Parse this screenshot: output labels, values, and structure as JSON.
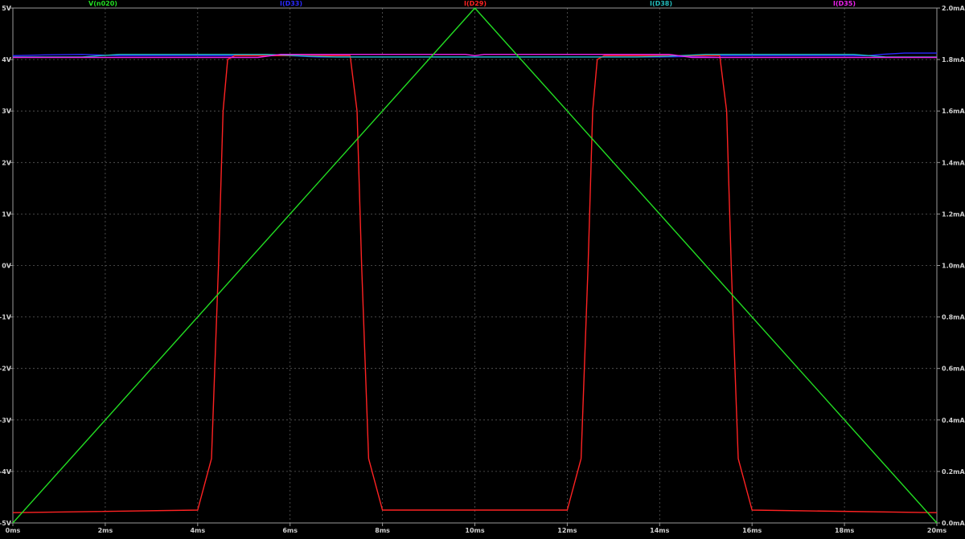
{
  "chart_data": {
    "type": "line",
    "background": "#000000",
    "grid": true,
    "grid_color": "#5a5a5a",
    "axis_color": "#9a9a9a",
    "tick_label_color": "#d0d0d0",
    "x_axis": {
      "range": [
        0,
        20
      ],
      "ticks": [
        0,
        2,
        4,
        6,
        8,
        10,
        12,
        14,
        16,
        18,
        20
      ],
      "tick_labels": [
        "0ms",
        "2ms",
        "4ms",
        "6ms",
        "8ms",
        "10ms",
        "12ms",
        "14ms",
        "16ms",
        "18ms",
        "20ms"
      ]
    },
    "y_left": {
      "range": [
        -5,
        5
      ],
      "ticks": [
        -5,
        -4,
        -3,
        -2,
        -1,
        0,
        1,
        2,
        3,
        4,
        5
      ],
      "tick_labels": [
        "-5V",
        "-4V",
        "-3V",
        "-2V",
        "-1V",
        "0V",
        "1V",
        "2V",
        "3V",
        "4V",
        "5V"
      ]
    },
    "y_right": {
      "range": [
        0,
        2
      ],
      "ticks": [
        0,
        0.2,
        0.4,
        0.6,
        0.8,
        1.0,
        1.2,
        1.4,
        1.6,
        1.8,
        2.0
      ],
      "tick_labels": [
        "0.0mA",
        "0.2mA",
        "0.4mA",
        "0.6mA",
        "0.8mA",
        "1.0mA",
        "1.2mA",
        "1.4mA",
        "1.6mA",
        "1.8mA",
        "2.0mA"
      ]
    },
    "legend_position": "top",
    "series": [
      {
        "name": "V(n020)",
        "color": "#22dd22",
        "axis": "left",
        "x": [
          0,
          10,
          20
        ],
        "y": [
          -5,
          5,
          -5
        ]
      },
      {
        "name": "I(D33)",
        "color": "#2a2aff",
        "axis": "right",
        "x": [
          0,
          0.7,
          1.5,
          2.3,
          5.5,
          6.0,
          6.6,
          14.0,
          14.7,
          15.3,
          18.5,
          18.8,
          19.3,
          20
        ],
        "y": [
          1.815,
          1.818,
          1.82,
          1.815,
          1.815,
          1.815,
          1.81,
          1.81,
          1.812,
          1.815,
          1.815,
          1.82,
          1.825,
          1.825
        ]
      },
      {
        "name": "I(D29)",
        "color": "#ff2222",
        "axis": "right",
        "x": [
          0,
          4.0,
          4.3,
          4.45,
          4.55,
          4.65,
          4.8,
          7.3,
          7.45,
          7.55,
          7.7,
          8.0,
          12.0,
          12.3,
          12.45,
          12.55,
          12.65,
          12.8,
          15.3,
          15.45,
          15.55,
          15.7,
          16.0,
          20
        ],
        "y": [
          0.04,
          0.05,
          0.25,
          1.0,
          1.6,
          1.8,
          1.815,
          1.815,
          1.6,
          1.0,
          0.25,
          0.05,
          0.05,
          0.25,
          1.0,
          1.6,
          1.8,
          1.815,
          1.815,
          1.6,
          1.0,
          0.25,
          0.05,
          0.04
        ]
      },
      {
        "name": "I(D38)",
        "color": "#22bbbb",
        "axis": "right",
        "x": [
          0,
          1.5,
          2.3,
          5.5,
          6.4,
          7.0,
          13.5,
          14.2,
          15.0,
          18.2,
          18.9,
          20
        ],
        "y": [
          1.81,
          1.81,
          1.82,
          1.82,
          1.813,
          1.81,
          1.81,
          1.813,
          1.82,
          1.82,
          1.81,
          1.81
        ]
      },
      {
        "name": "I(D35)",
        "color": "#ee22ee",
        "axis": "right",
        "x": [
          0,
          5.3,
          5.8,
          9.8,
          10.0,
          10.2,
          14.2,
          14.7,
          20
        ],
        "y": [
          1.808,
          1.808,
          1.82,
          1.82,
          1.815,
          1.82,
          1.82,
          1.808,
          1.808
        ]
      }
    ]
  }
}
